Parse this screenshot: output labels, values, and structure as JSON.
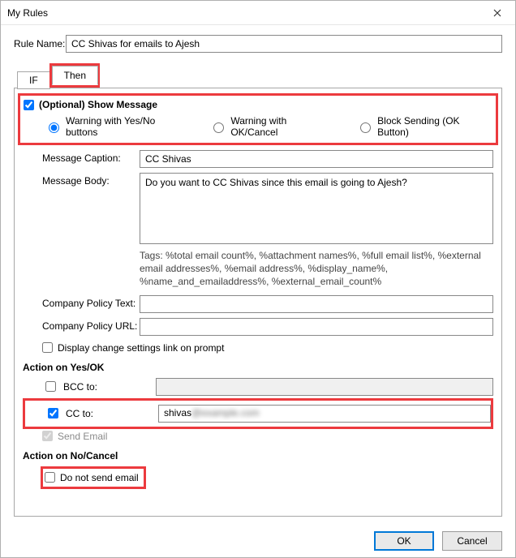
{
  "window": {
    "title": "My Rules"
  },
  "rule": {
    "name_label": "Rule Name:",
    "name_value": "CC Shivas for emails to Ajesh"
  },
  "tabs": {
    "if": "IF",
    "then": "Then"
  },
  "show_message": {
    "checkbox_label": "(Optional) Show Message",
    "checked": true,
    "radios": {
      "warning_yes_no": "Warning with Yes/No buttons",
      "warning_ok_cancel": "Warning with OK/Cancel",
      "block_sending": "Block Sending (OK Button)",
      "selected": "warning_yes_no"
    },
    "caption_label": "Message Caption:",
    "caption_value": "CC Shivas",
    "body_label": "Message Body:",
    "body_value": "Do you want to CC Shivas since this email is going to Ajesh?",
    "tags_text": "Tags: %total email count%, %attachment names%, %full email list%, %external email addresses%, %email address%, %display_name%, %name_and_emailaddress%, %external_email_count%",
    "policy_text_label": "Company Policy Text:",
    "policy_text_value": "",
    "policy_url_label": "Company Policy URL:",
    "policy_url_value": "",
    "display_link_label": "Display change settings link on prompt",
    "display_link_checked": false
  },
  "action_yes": {
    "heading": "Action on Yes/OK",
    "bcc_label": "BCC to:",
    "bcc_checked": false,
    "bcc_value": "",
    "cc_label": "CC to:",
    "cc_checked": true,
    "cc_value": "shivas",
    "send_email_label": "Send Email",
    "send_email_checked": true
  },
  "action_no": {
    "heading": "Action on No/Cancel",
    "dns_label": "Do not send email",
    "dns_checked": false
  },
  "buttons": {
    "ok": "OK",
    "cancel": "Cancel"
  }
}
